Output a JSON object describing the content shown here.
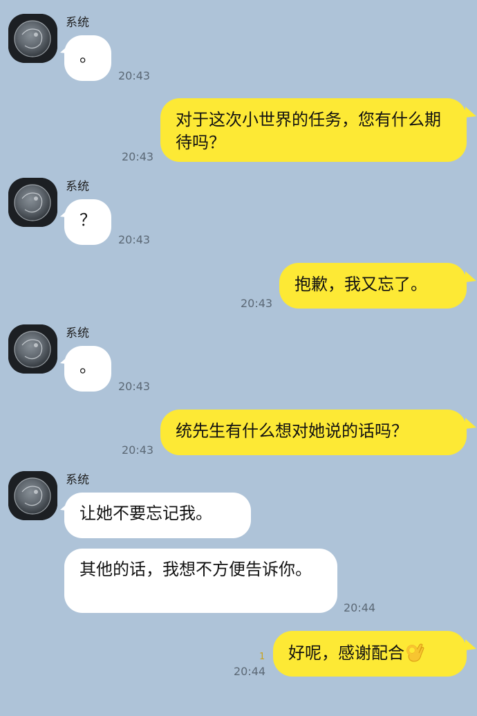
{
  "sender_name": "系统",
  "messages": [
    {
      "from": "system",
      "text": "。",
      "time": "20:43"
    },
    {
      "from": "me",
      "text": "对于这次小世界的任务，您有什么期待吗？",
      "time": "20:43"
    },
    {
      "from": "system",
      "text": "？",
      "time": "20:43"
    },
    {
      "from": "me",
      "text": "抱歉，我又忘了。",
      "time": "20:43"
    },
    {
      "from": "system",
      "text": "。",
      "time": "20:43"
    },
    {
      "from": "me",
      "text": "统先生有什么想对她说的话吗？",
      "time": "20:43"
    },
    {
      "from": "system",
      "text": "让她不要忘记我。",
      "time": ""
    },
    {
      "from": "system",
      "text": "其他的话，我想不方便告诉你。",
      "time": "20:44"
    },
    {
      "from": "me",
      "text": "好呢，感谢配合",
      "emoji": "ok-hand-icon",
      "time": "20:44",
      "read_count": "1"
    }
  ],
  "colors": {
    "background": "#aec3d8",
    "incoming_bubble": "#ffffff",
    "outgoing_bubble": "#fde935"
  }
}
